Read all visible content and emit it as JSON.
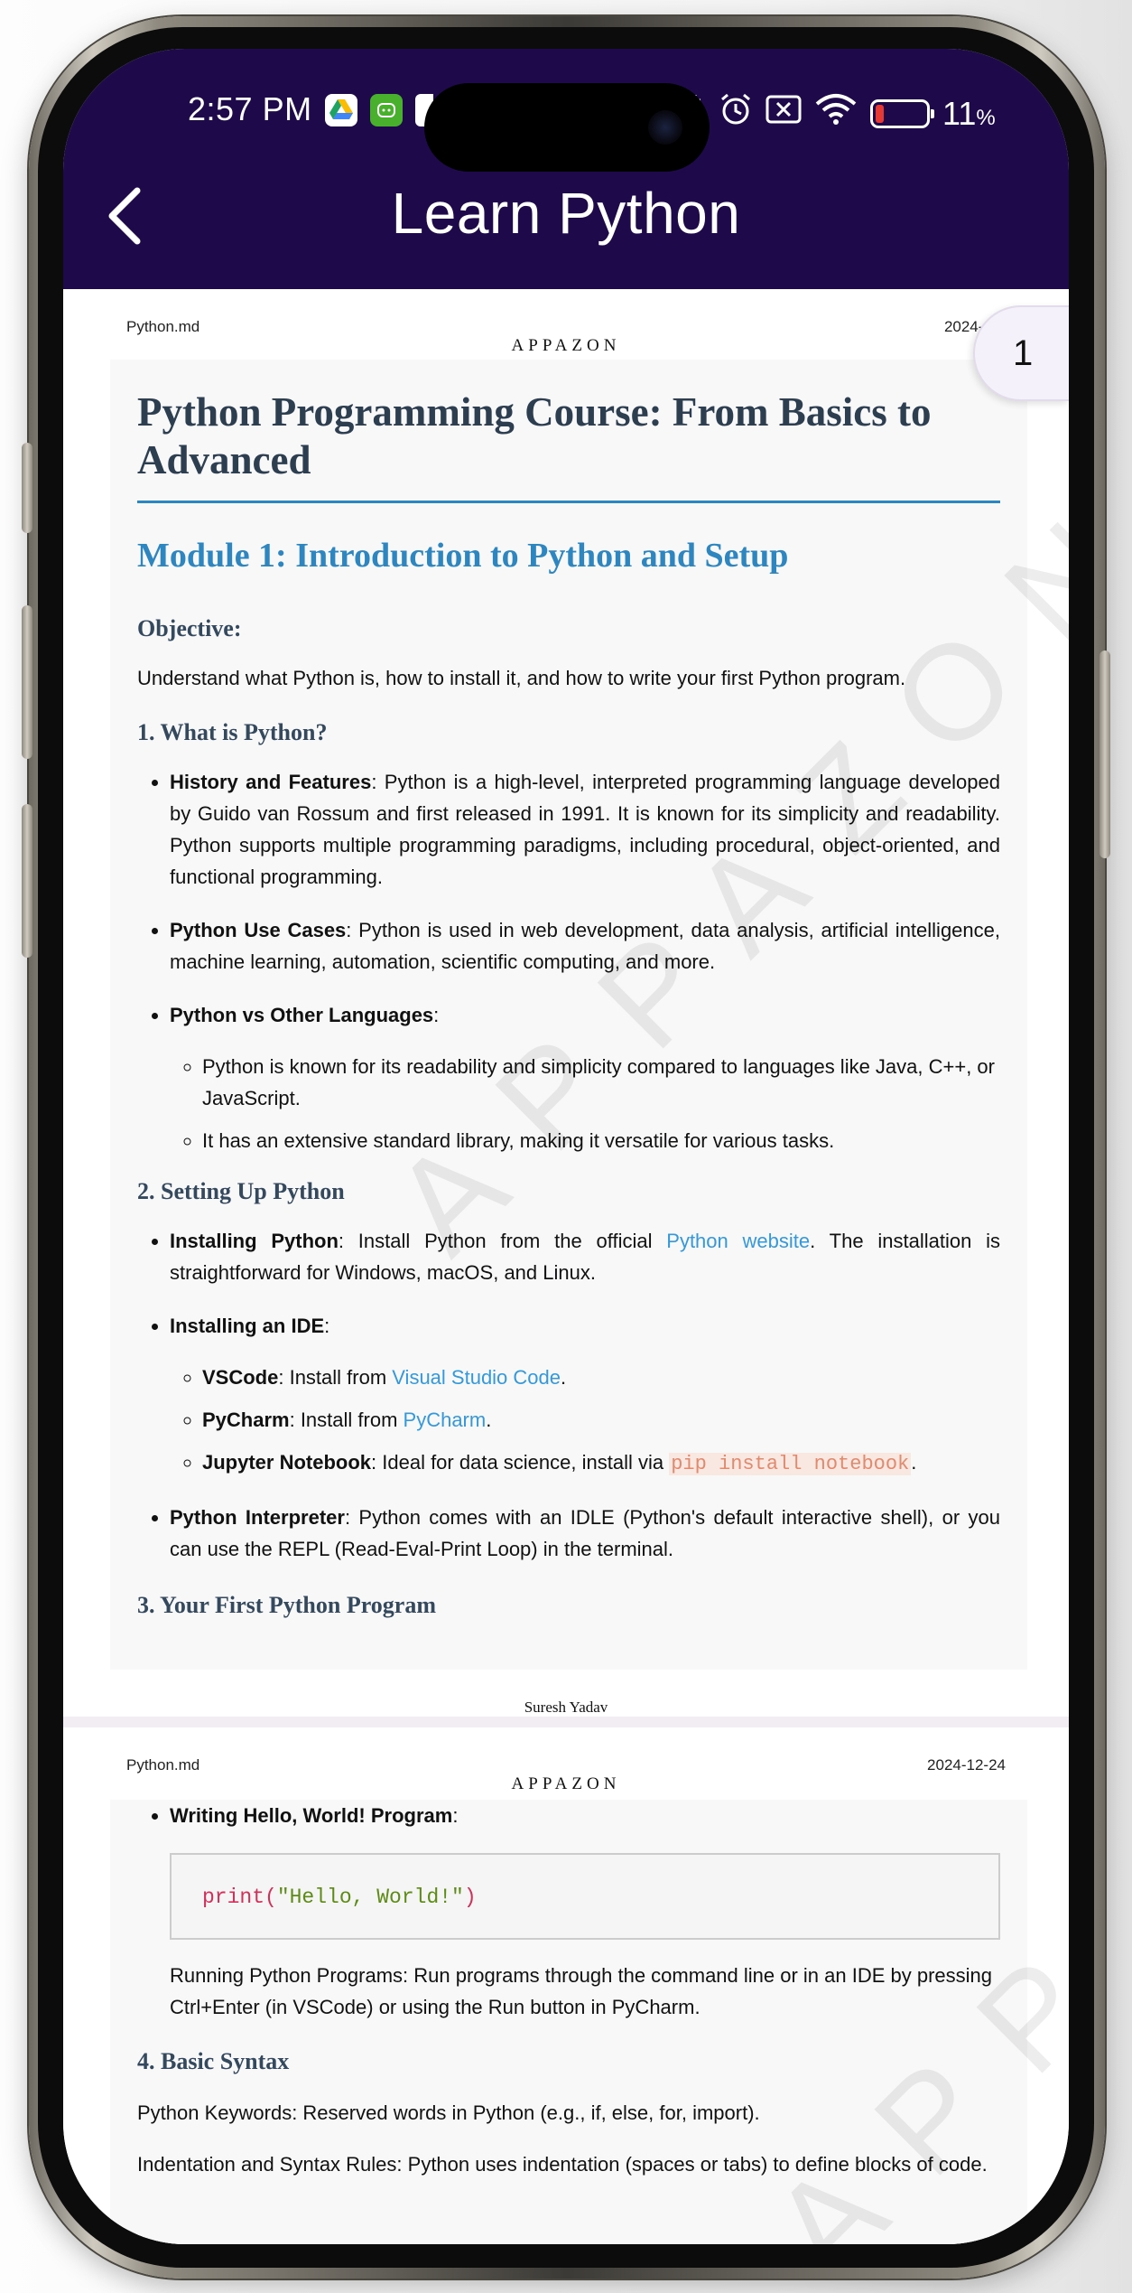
{
  "status_bar": {
    "time": "2:57 PM",
    "battery_percent": "11",
    "battery_unit": "%",
    "battery_level": 0.11,
    "icons": [
      "google-drive-icon",
      "android-app-icon",
      "mute-icon",
      "alarm-icon",
      "no-sim-icon",
      "wifi-icon",
      "battery-icon"
    ]
  },
  "app_bar": {
    "title": "Learn Python",
    "back_icon": "chevron-left-icon"
  },
  "page_indicator": "1",
  "page1": {
    "filename": "Python.md",
    "date": "2024-12-",
    "brand": "APPAZON",
    "watermark": "APPAZON",
    "title": "Python Programming Course: From Basics to Advanced",
    "module_title": "Module 1: Introduction to Python and Setup",
    "objective_heading": "Objective:",
    "objective_text": "Understand what Python is, how to install it, and how to write your first Python program.",
    "section1_heading": "1. What is Python?",
    "history_label": "History and Features",
    "history_text": ": Python is a high-level, interpreted programming language developed by Guido van Rossum and first released in 1991. It is known for its simplicity and readability. Python supports multiple programming paradigms, including procedural, object-oriented, and functional programming.",
    "usecases_label": "Python Use Cases",
    "usecases_text": ": Python is used in web development, data analysis, artificial intelligence, machine learning, automation, scientific computing, and more.",
    "vs_label": "Python vs Other Languages",
    "vs_colon": ":",
    "vs_item1": "Python is known for its readability and simplicity compared to languages like Java, C++, or JavaScript.",
    "vs_item2": "It has an extensive standard library, making it versatile for various tasks.",
    "section2_heading": "2. Setting Up Python",
    "install_label": "Installing Python",
    "install_text_before": ": Install Python from the official ",
    "install_link": "Python website",
    "install_text_after": ". The installation is straightforward for Windows, macOS, and Linux.",
    "ide_label": "Installing an IDE",
    "ide_colon": ":",
    "vscode_label": "VSCode",
    "vscode_text": ": Install from ",
    "vscode_link": "Visual Studio Code",
    "pycharm_label": "PyCharm",
    "pycharm_text": ": Install from ",
    "pycharm_link": "PyCharm",
    "jupyter_label": "Jupyter Notebook",
    "jupyter_text": ": Ideal for data science, install via ",
    "jupyter_code": "pip install notebook",
    "period": ".",
    "interpreter_label": "Python Interpreter",
    "interpreter_text": ": Python comes with an IDLE (Python's default interactive shell), or you can use the REPL (Read-Eval-Print Loop) in the terminal.",
    "section3_heading": "3. Your First Python Program",
    "footer_name": "Suresh Yadav",
    "footer_page": "/"
  },
  "page2": {
    "filename": "Python.md",
    "date": "2024-12-24",
    "brand": "APPAZON",
    "watermark": "APPAZON",
    "hello_label": "Writing Hello, World! Program",
    "hello_colon": ":",
    "code_fn": "print(",
    "code_str": "\"Hello, World!\"",
    "code_close": ")",
    "running_text": "Running Python Programs: Run programs through the command line or in an IDE by pressing Ctrl+Enter (in VSCode) or using the Run button in PyCharm.",
    "section4_heading": "4. Basic Syntax",
    "keywords_text": "Python Keywords: Reserved words in Python (e.g., if, else, for, import).",
    "indent_text": "Indentation and Syntax Rules: Python uses indentation (spaces or tabs) to define blocks of code."
  },
  "colors": {
    "app_bar": "#1e0a4a",
    "title_text": "#2c3e50",
    "module_blue": "#2e86c1",
    "link_blue": "#3498db",
    "inline_code": "#e08a6e"
  }
}
